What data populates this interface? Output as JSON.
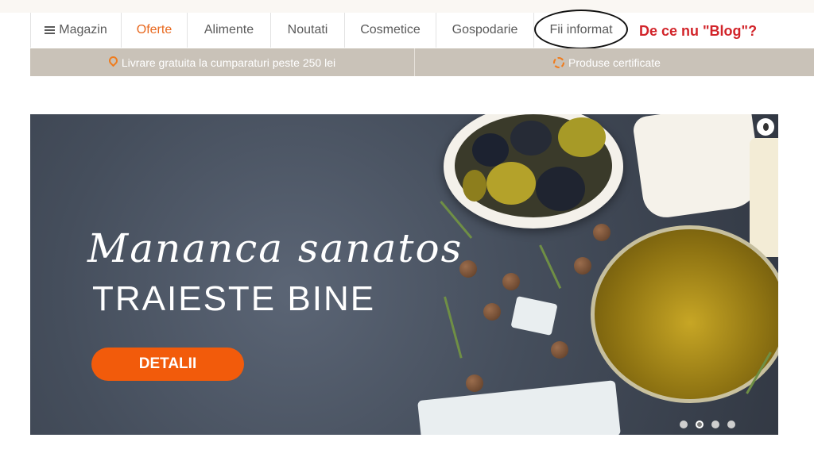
{
  "nav": {
    "items": [
      {
        "label": "Magazin",
        "icon": "menu-icon"
      },
      {
        "label": "Oferte",
        "active": true
      },
      {
        "label": "Alimente"
      },
      {
        "label": "Noutati"
      },
      {
        "label": "Cosmetice"
      },
      {
        "label": "Gospodarie"
      },
      {
        "label": "Fii informat"
      }
    ]
  },
  "annotation": {
    "text": "De ce nu \"Blog\"?",
    "color": "#d2242a"
  },
  "infobar": {
    "shipping": "Livrare gratuita la cumparaturi peste 250 lei",
    "certified": "Produse certificate"
  },
  "hero": {
    "headline": "Mananca sanatos",
    "subheadline": "TRAIESTE BINE",
    "cta_label": "DETALII",
    "slide_count": 4,
    "active_slide": 2
  },
  "colors": {
    "accent": "#e8681e",
    "cta": "#f25b0b",
    "infobar_bg": "#c9c2b8"
  }
}
